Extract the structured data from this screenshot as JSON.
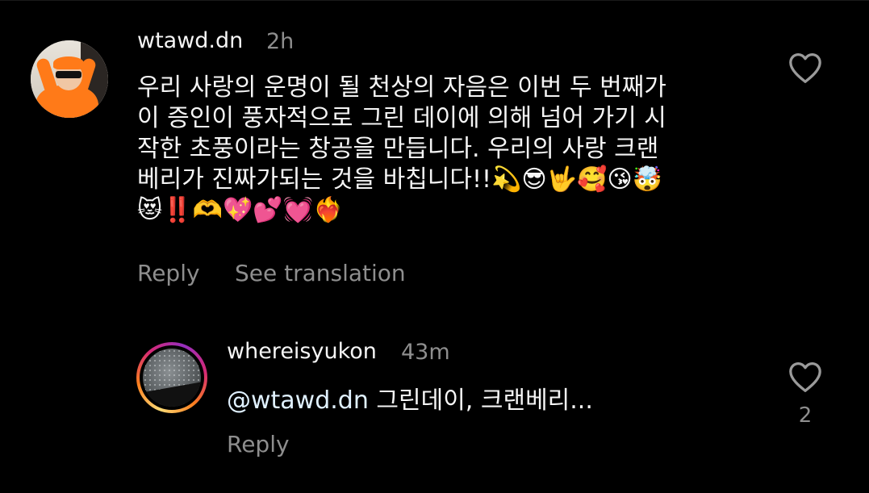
{
  "comment": {
    "username": "wtawd.dn",
    "time": "2h",
    "lines": [
      "우리 사랑의 운명이 될 천상의 자음은 이번 두 번째가",
      "이 증인이 풍자적으로 그린 데이에 의해 넘어 가기 시",
      "작한 초풍이라는 창공을 만듭니다. 우리의 사랑 크랜",
      "베리가 진짜가되는 것을 바칩니다!!💫😎🤟🥰😘🤯",
      "😻‼️🫶💖💕💓❤️‍🔥"
    ],
    "reply_label": "Reply",
    "translate_label": "See translation",
    "like_icon": "heart-outline-icon"
  },
  "reply": {
    "username": "whereisyukon",
    "time": "43m",
    "mention": "@wtawd.dn",
    "text": " 그린데이, 크랜베리...",
    "reply_label": "Reply",
    "like_count": "2",
    "like_icon": "heart-outline-icon"
  }
}
